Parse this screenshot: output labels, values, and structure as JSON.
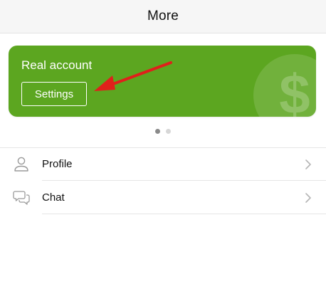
{
  "header": {
    "title": "More"
  },
  "account_card": {
    "title": "Real account",
    "settings_label": "Settings",
    "background_color": "#5ca620",
    "watermark_icon": "dollar-coin-icon"
  },
  "annotation": {
    "arrow_color": "#e0201b",
    "points_to": "settings-button"
  },
  "carousel": {
    "page_count": 2,
    "active_index": 0
  },
  "menu": {
    "items": [
      {
        "label": "Profile",
        "icon": "person-icon"
      },
      {
        "label": "Chat",
        "icon": "chat-bubbles-icon"
      }
    ]
  }
}
